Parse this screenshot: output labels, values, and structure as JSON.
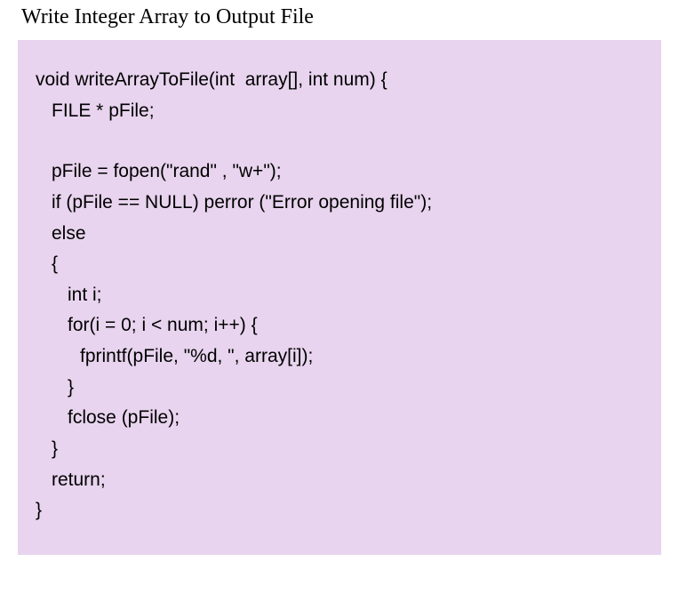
{
  "title": "Write Integer Array to Output File",
  "code": {
    "line1": "void writeArrayToFile(int  array[], int num) {",
    "line2": "FILE * pFile;",
    "line3": "pFile = fopen(\"rand\" , \"w+\");",
    "line4": "if (pFile == NULL) perror (\"Error opening file\");",
    "line5": "else",
    "line6": "{",
    "line7": "int i;",
    "line8": "for(i = 0; i < num; i++) {",
    "line9": "fprintf(pFile, \"%d, \", array[i]);",
    "line10": "}",
    "line11": "fclose (pFile);",
    "line12": "}",
    "line13": "return;",
    "line14": "}"
  }
}
